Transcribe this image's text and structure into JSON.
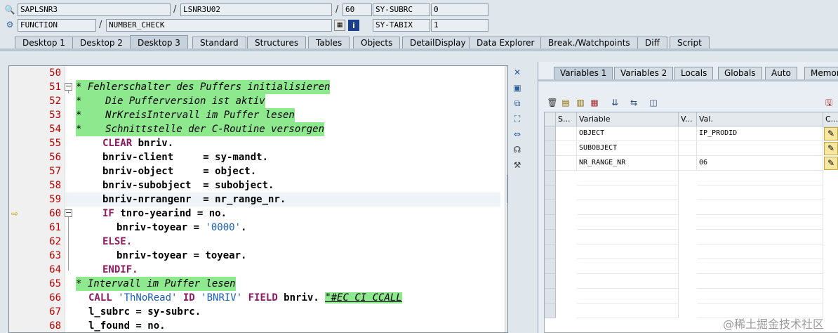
{
  "header": {
    "program": "SAPLSNR3",
    "include": "LSNR3U02",
    "line": "60",
    "sysubrc_label": "SY-SUBRC",
    "sysubrc_value": "0",
    "type": "FUNCTION",
    "name": "NUMBER_CHECK",
    "sytabix_label": "SY-TABIX",
    "sytabix_value": "1",
    "sep": "/"
  },
  "tabs": [
    "Desktop 1",
    "Desktop 2",
    "Desktop 3",
    "Standard",
    "Structures",
    "Tables",
    "Objects",
    "DetailDisplay",
    "Data Explorer",
    "Break./Watchpoints",
    "Diff",
    "Script"
  ],
  "code": [
    {
      "n": "50",
      "t": ""
    },
    {
      "n": "51",
      "t": "* Fehlerschalter des Puffers initialisieren"
    },
    {
      "n": "52",
      "t": "*    Die Pufferversion ist aktiv"
    },
    {
      "n": "53",
      "t": "*    NrKreisIntervall im Puffer lesen"
    },
    {
      "n": "54",
      "t": "*    Schnittstelle der C-Routine versorgen"
    },
    {
      "n": "55",
      "t1": "CLEAR",
      "t2": " bnriv."
    },
    {
      "n": "56",
      "t": "bnriv-client     = sy-mandt."
    },
    {
      "n": "57",
      "t": "bnriv-object     = object."
    },
    {
      "n": "58",
      "t": "bnriv-subobject  = subobject."
    },
    {
      "n": "59",
      "t": "bnriv-nrrangenr  = nr_range_nr."
    },
    {
      "n": "60",
      "t1": "IF",
      "t2": " tnro-yearind = no."
    },
    {
      "n": "61",
      "t2": "bnriv-toyear = ",
      "t3": "'0000'",
      "t4": "."
    },
    {
      "n": "62",
      "t1": "ELSE."
    },
    {
      "n": "63",
      "t": "bnriv-toyear = toyear."
    },
    {
      "n": "64",
      "t1": "ENDIF."
    },
    {
      "n": "65",
      "t": "* Intervall im Puffer lesen"
    },
    {
      "n": "66",
      "t1": "CALL",
      "t3": " 'ThNoRead'",
      "t1b": " ID",
      "t3b": " 'BNRIV'",
      "t1c": " FIELD",
      "t2": " bnriv.",
      "t5": "\"#EC CI CCALL"
    },
    {
      "n": "67",
      "t": "l_subrc = sy-subrc."
    },
    {
      "n": "68",
      "t": "l_found = no."
    }
  ],
  "right_tabs": [
    "Variables 1",
    "Variables 2",
    "Locals",
    "Globals",
    "Auto",
    "Memory"
  ],
  "grid": {
    "headers": [
      "S...",
      "Variable",
      "V...",
      "Val.",
      "C..."
    ],
    "rows": [
      {
        "var": "OBJECT",
        "val": "IP_PRODID"
      },
      {
        "var": "SUBOBJECT",
        "val": ""
      },
      {
        "var": "NR_RANGE_NR",
        "val": "06"
      }
    ]
  },
  "watermark": "@稀土掘金技术社区"
}
